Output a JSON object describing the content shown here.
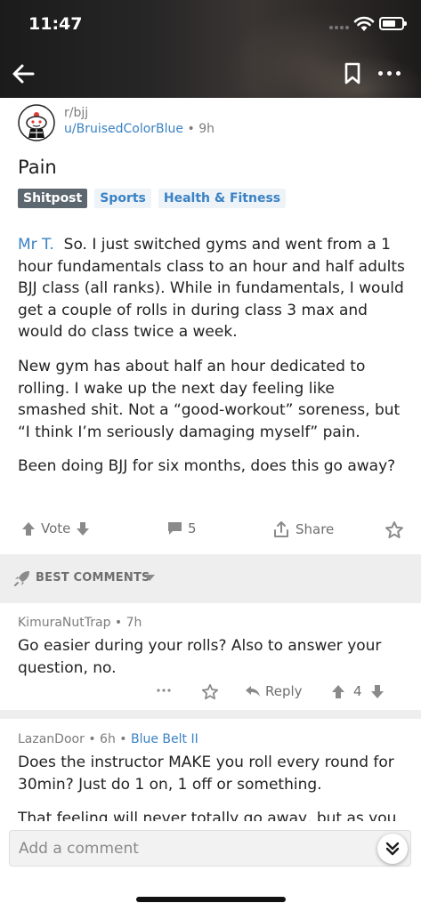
{
  "status_bar": {
    "time": "11:47"
  },
  "post": {
    "subreddit": "r/bjj",
    "author": "u/BruisedColorBlue",
    "age": "9h",
    "title": "Pain",
    "flairs": [
      "Shitpost",
      "Sports",
      "Health & Fitness"
    ],
    "mention": "Mr T.",
    "paragraphs": [
      "So. I just switched gyms and went from a 1 hour fundamentals class to an hour and half adults BJJ class (all ranks). While in fundamentals, I would get a couple of rolls in during class 3 max and would do class twice a week.",
      "New gym has about half an hour dedicated to rolling. I wake up the next day feeling like smashed shit. Not a “good-workout” soreness, but “I think I’m seriously damaging myself” pain.",
      "Been doing BJJ for six months, does this go away?"
    ],
    "actions": {
      "vote_label": "Vote",
      "comment_count": "5",
      "share_label": "Share"
    }
  },
  "comments_section": {
    "sort_label": "BEST COMMENTS"
  },
  "comments": [
    {
      "author": "KimuraNutTrap",
      "age": "7h",
      "flair": "",
      "body": "Go easier during your rolls? Also to answer your question, no.",
      "reply_label": "Reply",
      "score": "4"
    },
    {
      "author": "LazanDoor",
      "age": "6h",
      "flair": "Blue Belt II",
      "body": "Does the instructor MAKE you roll every round for 30min? Just do 1 on, 1 off or something.",
      "body2": "That feeling will never totally go away, but as you"
    }
  ],
  "composer": {
    "placeholder": "Add a comment"
  },
  "colors": {
    "link_blue": "#3a82c4",
    "flair_gray": "#5d6770",
    "meta_gray": "#7c7c7c"
  }
}
